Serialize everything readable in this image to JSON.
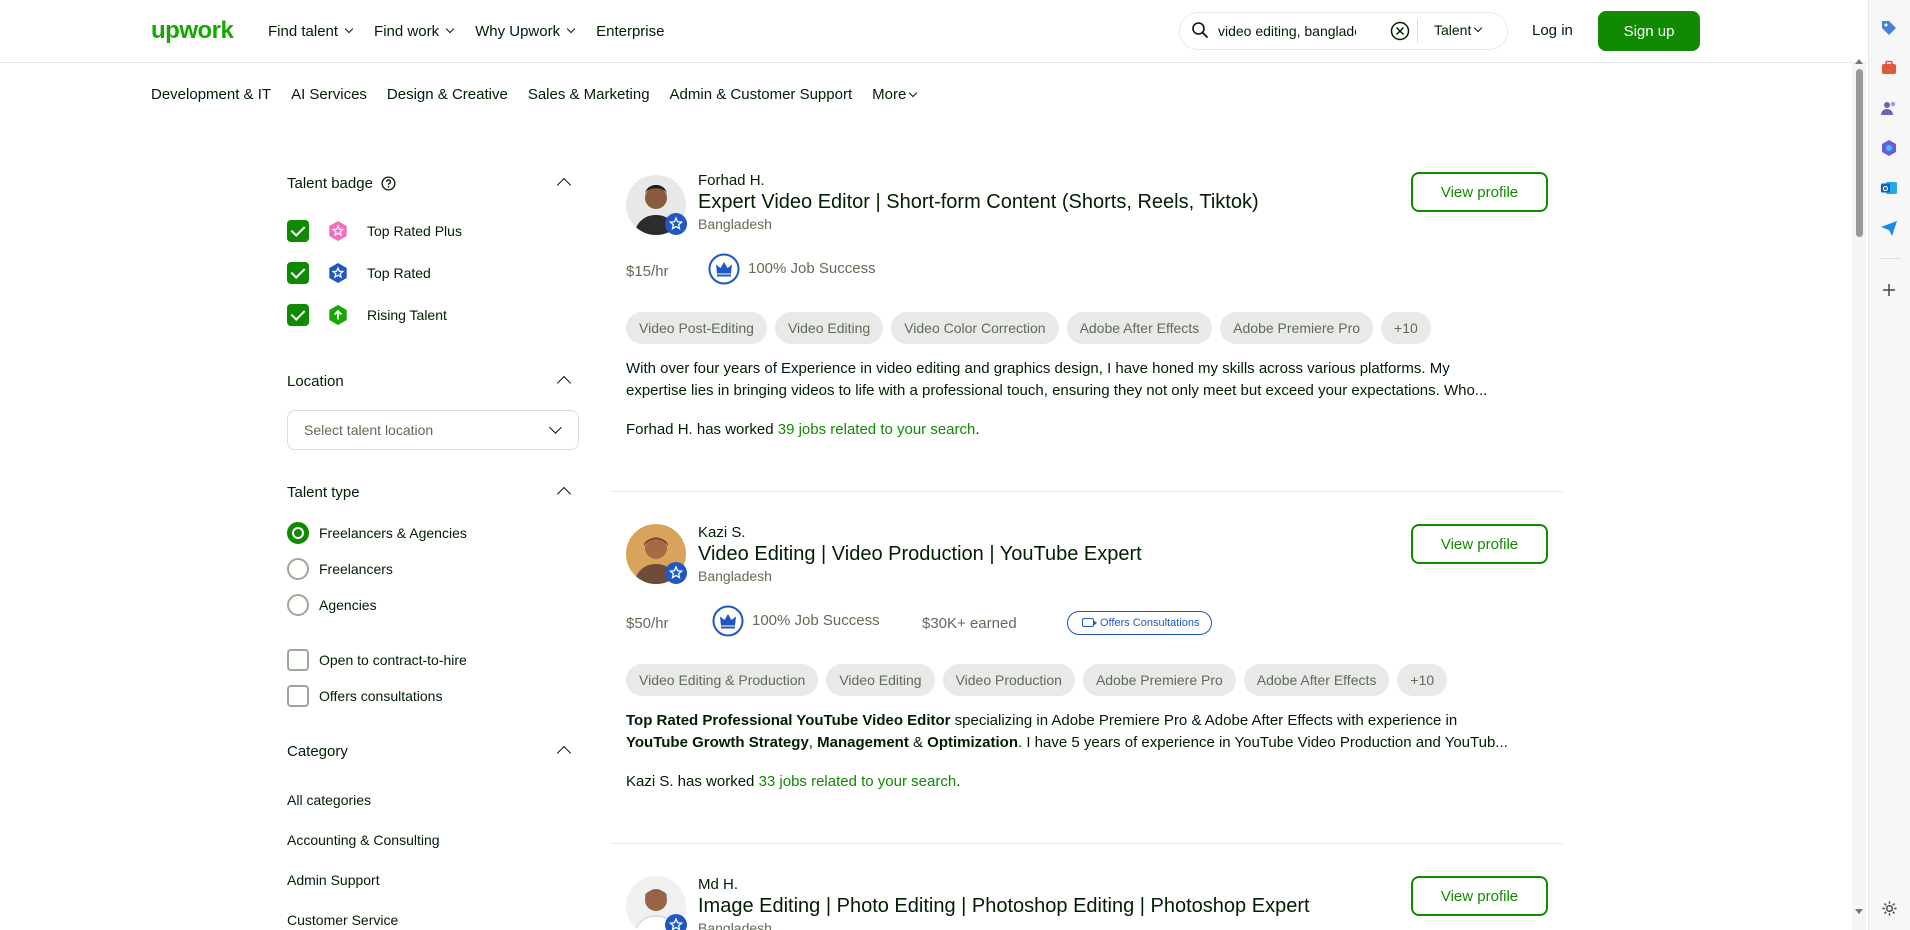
{
  "header": {
    "logo": "upwork",
    "nav": [
      "Find talent",
      "Find work",
      "Why Upwork",
      "Enterprise"
    ],
    "search_value": "video editing, banglades",
    "search_scope": "Talent",
    "login": "Log in",
    "signup": "Sign up"
  },
  "categories": [
    "Development & IT",
    "AI Services",
    "Design & Creative",
    "Sales & Marketing",
    "Admin & Customer Support",
    "More"
  ],
  "filters": {
    "talent_badge": {
      "title": "Talent badge",
      "items": [
        "Top Rated Plus",
        "Top Rated",
        "Rising Talent"
      ]
    },
    "location": {
      "title": "Location",
      "placeholder": "Select talent location"
    },
    "talent_type": {
      "title": "Talent type",
      "options": [
        "Freelancers & Agencies",
        "Freelancers",
        "Agencies"
      ],
      "checks": [
        "Open to contract-to-hire",
        "Offers consultations"
      ]
    },
    "category": {
      "title": "Category",
      "items": [
        "All categories",
        "Accounting & Consulting",
        "Admin Support",
        "Customer Service"
      ]
    }
  },
  "results": [
    {
      "name": "Forhad H.",
      "title": "Expert Video Editor | Short-form Content (Shorts, Reels, Tiktok)",
      "country": "Bangladesh",
      "rate": "$15/hr",
      "job_success": "100% Job Success",
      "skills": [
        "Video Post-Editing",
        "Video Editing",
        "Video Color Correction",
        "Adobe After Effects",
        "Adobe Premiere Pro",
        "+10"
      ],
      "desc_1": "With over four years of Experience in video editing and graphics design, I have honed my skills across various platforms. My",
      "desc_2": "expertise lies in bringing videos to life with a professional touch, ensuring they not only meet but exceed your expectations. Who...",
      "worked_prefix": "Forhad H. has worked ",
      "worked_link": "39 jobs related to your search",
      "view_profile": "View profile"
    },
    {
      "name": "Kazi S.",
      "title": "Video Editing | Video Production | YouTube Expert",
      "country": "Bangladesh",
      "rate": "$50/hr",
      "job_success": "100% Job Success",
      "earned": "$30K+ earned",
      "consult": "Offers Consultations",
      "skills": [
        "Video Editing & Production",
        "Video Editing",
        "Video Production",
        "Adobe Premiere Pro",
        "Adobe After Effects",
        "+10"
      ],
      "desc_b1": "Top Rated Professional YouTube Video Editor",
      "desc_t1": " specializing in Adobe Premiere Pro & Adobe After Effects with experience in",
      "desc_b2": "YouTube Growth Strategy",
      "desc_t2": ", ",
      "desc_b3": "Management",
      "desc_t3": " & ",
      "desc_b4": "Optimization",
      "desc_t4": ". I have 5 years of experience in YouTube Video Production and YouTub...",
      "worked_prefix": "Kazi S. has worked ",
      "worked_link": "33 jobs related to your search",
      "view_profile": "View profile"
    },
    {
      "name": "Md H.",
      "title": "Image Editing | Photo Editing | Photoshop Editing | Photoshop Expert",
      "country": "Bangladesh",
      "view_profile": "View profile"
    }
  ],
  "colors": {
    "brand": "#14a800",
    "primary_button": "#108a00",
    "badge_blue": "#1f57c3",
    "top_rated_plus": "#f66dbc",
    "rising_talent": "#14a800"
  }
}
